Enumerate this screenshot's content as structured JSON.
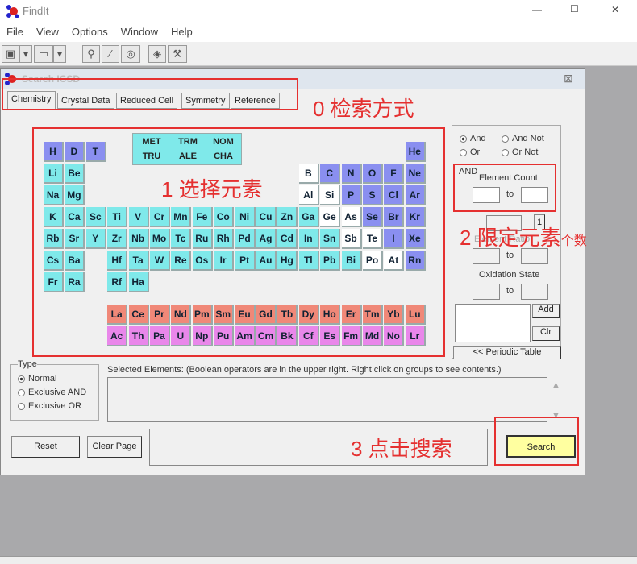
{
  "app": {
    "title": "FindIt",
    "window_controls": [
      "—",
      "☐",
      "✕"
    ]
  },
  "menu": [
    "File",
    "View",
    "Options",
    "Window",
    "Help"
  ],
  "toolbar": {
    "icons": [
      "save-icon",
      "dropdown-icon",
      "print-icon",
      "dropdown-icon",
      "search-icon",
      "pin-icon",
      "rings-icon",
      "diamond-icon",
      "tools-icon"
    ]
  },
  "child": {
    "title": "Search ICSD",
    "close": "⊠",
    "tabs": [
      "Chemistry",
      "Crystal Data",
      "Reduced Cell",
      "Symmetry",
      "Reference"
    ]
  },
  "groups": [
    "MET",
    "TRM",
    "NOM",
    "TRU",
    "ALE",
    "CHA"
  ],
  "table": {
    "rows": [
      [
        "H",
        "D",
        "T",
        null,
        null,
        null,
        null,
        null,
        null,
        null,
        null,
        null,
        null,
        null,
        null,
        null,
        null,
        "He"
      ],
      [
        "Li",
        "Be",
        null,
        null,
        null,
        null,
        null,
        null,
        null,
        null,
        null,
        null,
        "B",
        "C",
        "N",
        "O",
        "F",
        "Ne"
      ],
      [
        "Na",
        "Mg",
        null,
        null,
        null,
        null,
        null,
        null,
        null,
        null,
        null,
        null,
        "Al",
        "Si",
        "P",
        "S",
        "Cl",
        "Ar"
      ],
      [
        "K",
        "Ca",
        "Sc",
        "Ti",
        "V",
        "Cr",
        "Mn",
        "Fe",
        "Co",
        "Ni",
        "Cu",
        "Zn",
        "Ga",
        "Ge",
        "As",
        "Se",
        "Br",
        "Kr"
      ],
      [
        "Rb",
        "Sr",
        "Y",
        "Zr",
        "Nb",
        "Mo",
        "Tc",
        "Ru",
        "Rh",
        "Pd",
        "Ag",
        "Cd",
        "In",
        "Sn",
        "Sb",
        "Te",
        "I",
        "Xe"
      ],
      [
        "Cs",
        "Ba",
        null,
        "Hf",
        "Ta",
        "W",
        "Re",
        "Os",
        "Ir",
        "Pt",
        "Au",
        "Hg",
        "Tl",
        "Pb",
        "Bi",
        "Po",
        "At",
        "Rn"
      ],
      [
        "Fr",
        "Ra",
        null,
        "Rf",
        "Ha"
      ]
    ],
    "lanthanides": [
      "La",
      "Ce",
      "Pr",
      "Nd",
      "Pm",
      "Sm",
      "Eu",
      "Gd",
      "Tb",
      "Dy",
      "Ho",
      "Er",
      "Tm",
      "Yb",
      "Lu"
    ],
    "actinides": [
      "Ac",
      "Th",
      "Pa",
      "U",
      "Np",
      "Pu",
      "Am",
      "Cm",
      "Bk",
      "Cf",
      "Es",
      "Fm",
      "Md",
      "No",
      "Lr"
    ],
    "white": [
      "B",
      "Al",
      "Si",
      "Ge",
      "As",
      "Sb",
      "Te",
      "Po",
      "At"
    ],
    "purple": [
      "H",
      "D",
      "T",
      "He",
      "C",
      "N",
      "O",
      "F",
      "Ne",
      "P",
      "S",
      "Cl",
      "Ar",
      "Se",
      "Br",
      "Kr",
      "I",
      "Xe",
      "Rn"
    ],
    "colors": {
      "c": "#7fe9ea",
      "p": "#8a8ff0",
      "w": "#ffffff",
      "l": "#f08878",
      "a": "#e987ea"
    }
  },
  "bool": {
    "and": "And",
    "and_not": "And Not",
    "or": "Or",
    "or_not": "Or Not",
    "selected": "And"
  },
  "right": {
    "and_label": "AND",
    "element_count": "Element Count",
    "to": "to",
    "element_ratio": "Element Ratio",
    "spin": "1",
    "oxidation_state": "Oxidation State",
    "add": "Add",
    "clr": "Clr",
    "periodic_table": "<< Periodic Table"
  },
  "type": {
    "label": "Type",
    "options": [
      "Normal",
      "Exclusive AND",
      "Exclusive OR"
    ],
    "selected": "Normal"
  },
  "selected_label": "Selected Elements: (Boolean operators are in the upper right.  Right click on groups to see contents.)",
  "buttons": {
    "reset": "Reset",
    "clear_page": "Clear Page",
    "search": "Search"
  },
  "annotations": {
    "a0": "0 检索方式",
    "a1": "1 选择元素",
    "a2": "2 限定元素",
    "a2b": "个数",
    "a3": "3 点击搜索"
  }
}
